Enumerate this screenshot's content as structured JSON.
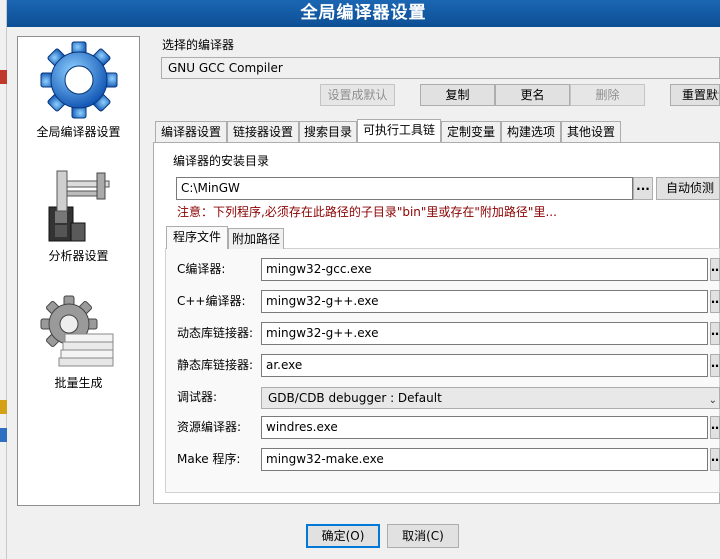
{
  "window": {
    "title": "全局编译器设置"
  },
  "sidebar": {
    "items": [
      {
        "label": "全局编译器设置",
        "icon": "gear-icon"
      },
      {
        "label": "分析器设置",
        "icon": "caliper-icon"
      },
      {
        "label": "批量生成",
        "icon": "batch-gear-icon"
      }
    ]
  },
  "compiler_select": {
    "label": "选择的编译器",
    "value": "GNU GCC Compiler"
  },
  "compiler_buttons": {
    "set_default": "设置成默认",
    "copy": "复制",
    "rename": "更名",
    "delete": "删除",
    "reset_default": "重置默认"
  },
  "tabs": [
    "编译器设置",
    "链接器设置",
    "搜索目录",
    "可执行工具链",
    "定制变量",
    "构建选项",
    "其他设置"
  ],
  "install_dir": {
    "label": "编译器的安装目录",
    "value": "C:\\MinGW",
    "browse": "...",
    "auto_detect": "自动侦测",
    "note": "注意：下列程序,必须存在此路径的子目录\"bin\"里或存在\"附加路径\"里..."
  },
  "subtabs": [
    "程序文件",
    "附加路径"
  ],
  "programs": [
    {
      "label": "C编译器:",
      "value": "mingw32-gcc.exe"
    },
    {
      "label": "C++编译器:",
      "value": "mingw32-g++.exe"
    },
    {
      "label": "动态库链接器:",
      "value": "mingw32-g++.exe"
    },
    {
      "label": "静态库链接器:",
      "value": "ar.exe"
    },
    {
      "label": "调试器:",
      "value": "GDB/CDB debugger : Default"
    },
    {
      "label": "资源编译器:",
      "value": "windres.exe"
    },
    {
      "label": "Make 程序:",
      "value": "mingw32-make.exe"
    }
  ],
  "footer": {
    "ok": "确定(O)",
    "cancel": "取消(C)"
  },
  "colors": {
    "titlebar": "#1b66b3",
    "note": "#8b0000"
  }
}
